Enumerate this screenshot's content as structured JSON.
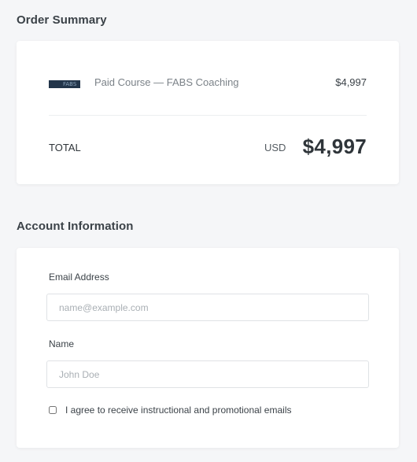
{
  "order_summary": {
    "title": "Order Summary",
    "item": {
      "thumbnail_icon": "course-thumbnail",
      "thumbnail_text": "FABS",
      "name": "Paid Course — FABS Coaching",
      "price": "$4,997"
    },
    "total": {
      "label": "TOTAL",
      "currency": "USD",
      "amount": "$4,997"
    }
  },
  "account_information": {
    "title": "Account Information",
    "email": {
      "label": "Email Address",
      "placeholder": "name@example.com",
      "value": ""
    },
    "name": {
      "label": "Name",
      "placeholder": "John Doe",
      "value": ""
    },
    "consent": {
      "label": "I agree to receive instructional and promotional emails",
      "checked": false
    }
  },
  "colors": {
    "page_background": "#f5f6f8",
    "card_background": "#ffffff",
    "thumbnail": "#22354a",
    "text_primary": "#2f353a",
    "text_muted": "#7b8288"
  }
}
